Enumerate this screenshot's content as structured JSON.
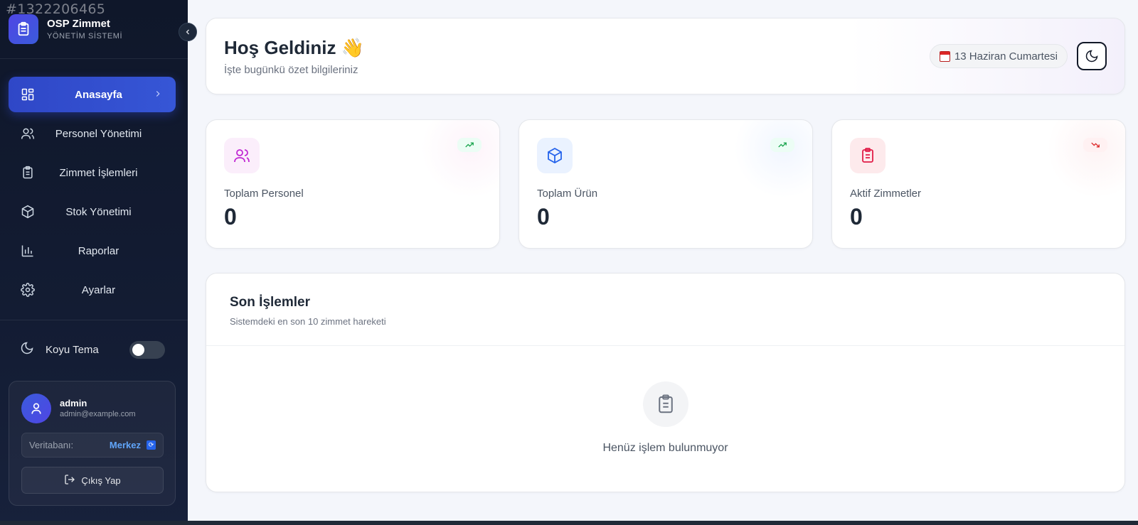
{
  "overlay_id": "#1322206465",
  "sidebar": {
    "brand_title": "OSP Zimmet",
    "brand_subtitle": "YÖNETİM SİSTEMİ",
    "items": [
      {
        "label": "Anasayfa",
        "icon": "dashboard-icon",
        "active": true
      },
      {
        "label": "Personel Yönetimi",
        "icon": "users-icon"
      },
      {
        "label": "Zimmet İşlemleri",
        "icon": "clipboard-icon"
      },
      {
        "label": "Stok Yönetimi",
        "icon": "box-icon"
      },
      {
        "label": "Raporlar",
        "icon": "bar-chart-icon"
      },
      {
        "label": "Ayarlar",
        "icon": "gear-icon"
      }
    ],
    "theme_label": "Koyu Tema",
    "theme_enabled": false,
    "user": {
      "name": "admin",
      "email": "admin@example.com",
      "db_label": "Veritabanı:",
      "db_value": "Merkez"
    },
    "logout_label": "Çıkış Yap"
  },
  "header": {
    "title": "Hoş Geldiniz 👋",
    "subtitle": "İşte bugünkü özet bilgileriniz",
    "date": "13 Haziran Cumartesi"
  },
  "stats": [
    {
      "label": "Toplam Personel",
      "value": "0",
      "icon": "users-icon",
      "trend": "up"
    },
    {
      "label": "Toplam Ürün",
      "value": "0",
      "icon": "box-icon",
      "trend": "up"
    },
    {
      "label": "Aktif Zimmetler",
      "value": "0",
      "icon": "clipboard-icon",
      "trend": "down"
    }
  ],
  "activity": {
    "title": "Son İşlemler",
    "subtitle": "Sistemdeki en son 10 zimmet hareketi",
    "empty_text": "Henüz işlem bulunmuyor"
  },
  "colors": {
    "accent": "#3656d6",
    "sidebar_bg": "#0f172a",
    "trend_up": "#16a34a",
    "trend_down": "#dc2626"
  }
}
